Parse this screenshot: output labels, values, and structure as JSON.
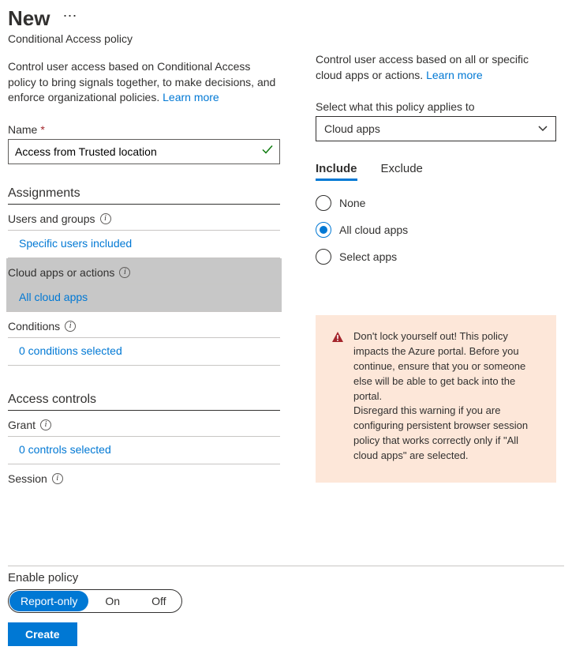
{
  "header": {
    "title": "New",
    "subtitle": "Conditional Access policy"
  },
  "left": {
    "description_pre": "Control user access based on Conditional Access policy to bring signals together, to make decisions, and enforce organizational policies. ",
    "learn_more": "Learn more",
    "name_label": "Name",
    "name_value": "Access from Trusted location",
    "assignments_title": "Assignments",
    "users_groups_label": "Users and groups",
    "users_groups_value": "Specific users included",
    "cloud_apps_label": "Cloud apps or actions",
    "cloud_apps_value": "All cloud apps",
    "conditions_label": "Conditions",
    "conditions_value": "0 conditions selected",
    "access_controls_title": "Access controls",
    "grant_label": "Grant",
    "grant_value": "0 controls selected",
    "session_label": "Session"
  },
  "right": {
    "description_pre": "Control user access based on all or specific cloud apps or actions. ",
    "learn_more": "Learn more",
    "select_label": "Select what this policy applies to",
    "select_value": "Cloud apps",
    "tabs": {
      "include": "Include",
      "exclude": "Exclude"
    },
    "radios": {
      "none": "None",
      "all": "All cloud apps",
      "select": "Select apps"
    },
    "warning_line1": "Don't lock yourself out! This policy impacts the Azure portal. Before you continue, ensure that you or someone else will be able to get back into the portal.",
    "warning_line2": "Disregard this warning if you are configuring persistent browser session policy that works correctly only if \"All cloud apps\" are selected."
  },
  "footer": {
    "enable_label": "Enable policy",
    "report_only": "Report-only",
    "on": "On",
    "off": "Off",
    "create": "Create"
  }
}
